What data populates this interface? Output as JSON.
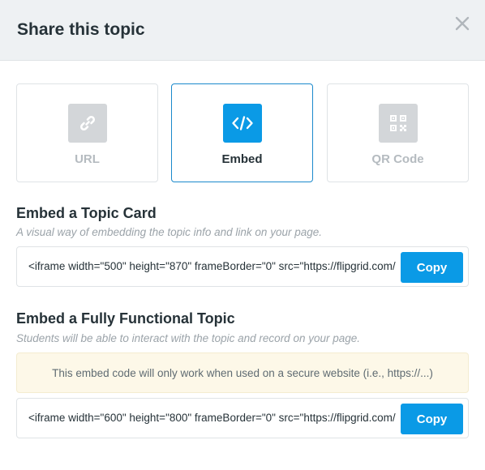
{
  "header": {
    "title": "Share this topic",
    "close_icon": "close-icon"
  },
  "tabs": [
    {
      "id": "url",
      "label": "URL",
      "icon": "link-icon",
      "active": false
    },
    {
      "id": "embed",
      "label": "Embed",
      "icon": "code-icon",
      "active": true
    },
    {
      "id": "qr",
      "label": "QR Code",
      "icon": "qr-code-icon",
      "active": false
    }
  ],
  "topic_card": {
    "title": "Embed a Topic Card",
    "description": "A visual way of embedding the topic info and link on your page.",
    "code": "<iframe width=\"500\" height=\"870\" frameBorder=\"0\" src=\"https://flipgrid.com/",
    "copy_label": "Copy"
  },
  "functional_topic": {
    "title": "Embed a Fully Functional Topic",
    "description": "Students will be able to interact with the topic and record on your page.",
    "warning": "This embed code will only work when used on a secure website (i.e., https://...)",
    "code": "<iframe width=\"600\" height=\"800\" frameBorder=\"0\" src=\"https://flipgrid.com/",
    "copy_label": "Copy"
  },
  "colors": {
    "accent": "#0a9ae6",
    "header_bg": "#eef1f3",
    "warning_bg": "#fdf8e8"
  }
}
